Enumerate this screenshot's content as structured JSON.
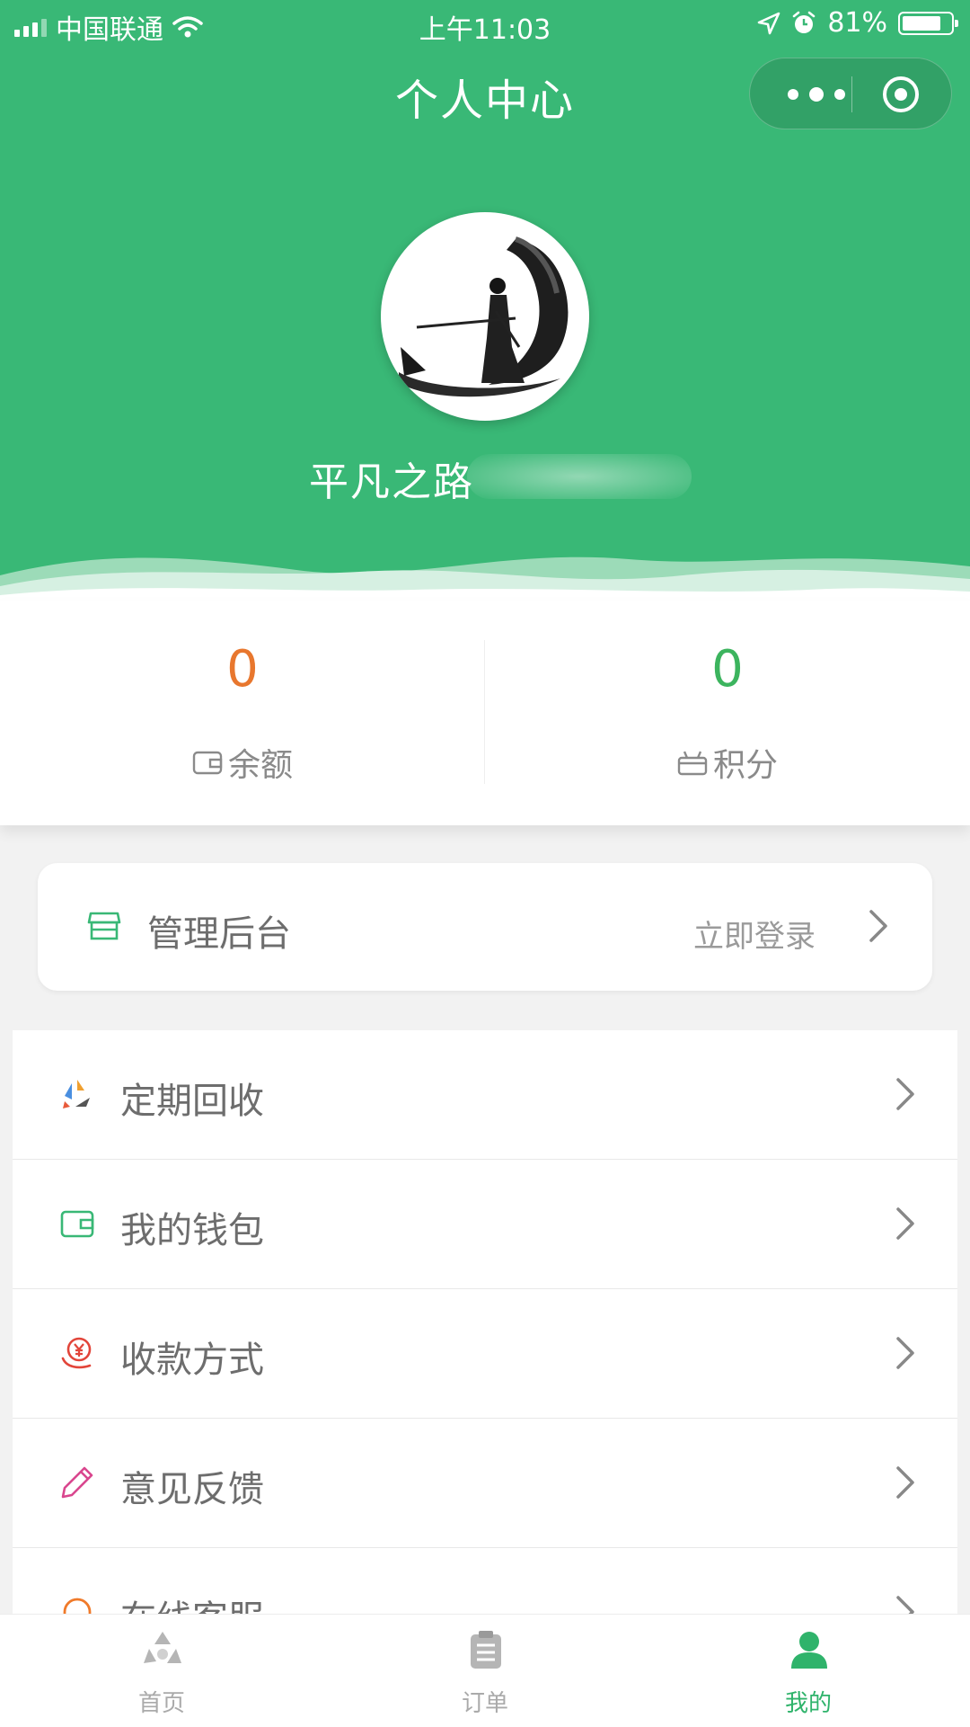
{
  "status_bar": {
    "carrier": "中国联通",
    "time": "上午11:03",
    "battery": "81%",
    "battery_level": 0.81
  },
  "nav": {
    "title": "个人中心"
  },
  "profile": {
    "username": "平凡之路"
  },
  "stats": [
    {
      "value": "0",
      "label": "余额",
      "icon": "wallet-icon",
      "color": "#e8772e"
    },
    {
      "value": "0",
      "label": "积分",
      "icon": "gift-box-icon",
      "color": "#3cb45e"
    }
  ],
  "admin": {
    "label": "管理后台",
    "action": "立即登录",
    "icon": "store-icon"
  },
  "menu": [
    {
      "label": "定期回收",
      "icon": "recycle-icon"
    },
    {
      "label": "我的钱包",
      "icon": "wallet-icon"
    },
    {
      "label": "收款方式",
      "icon": "yuan-payment-icon"
    },
    {
      "label": "意见反馈",
      "icon": "pencil-icon"
    },
    {
      "label": "在线客服",
      "icon": "headset-icon"
    }
  ],
  "tabbar": [
    {
      "label": "首页",
      "icon": "recycle-icon",
      "active": false
    },
    {
      "label": "订单",
      "icon": "clipboard-icon",
      "active": false
    },
    {
      "label": "我的",
      "icon": "user-icon",
      "active": true
    }
  ],
  "colors": {
    "primary": "#39b876",
    "balance": "#e8772e",
    "points": "#3cb45e",
    "tab_active": "#2fb36b"
  }
}
